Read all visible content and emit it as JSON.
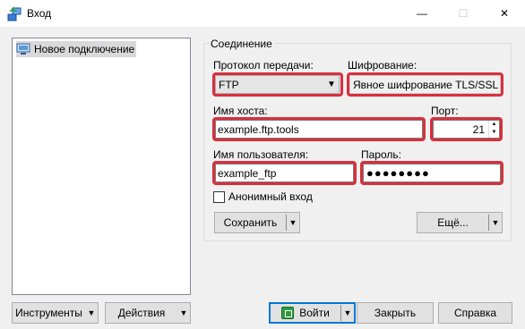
{
  "window": {
    "title": "Вход",
    "minimize": "—",
    "maximize": "☐",
    "close": "✕"
  },
  "tree": {
    "items": [
      {
        "label": "Новое подключение"
      }
    ]
  },
  "session": {
    "group_title": "Соединение",
    "protocol_label": "Протокол передачи:",
    "protocol_value": "FTP",
    "encryption_label": "Шифрование:",
    "encryption_value": "Явное шифрование TLS/SSL",
    "host_label": "Имя хоста:",
    "host_value": "example.ftp.tools",
    "port_label": "Порт:",
    "port_value": "21",
    "user_label": "Имя пользователя:",
    "user_value": "example_ftp",
    "password_label": "Пароль:",
    "password_value": "●●●●●●●●",
    "anonymous_label": "Анонимный вход",
    "anonymous_checked": false,
    "save_label": "Сохранить",
    "advanced_label": "Ещё..."
  },
  "footer": {
    "tools_label": "Инструменты",
    "actions_label": "Действия",
    "login_label": "Войти",
    "close_label": "Закрыть",
    "help_label": "Справка"
  },
  "colors": {
    "highlight": "#d92f3d",
    "default_button_border": "#0078d7",
    "selection": "#d9d9d9"
  },
  "icons": {
    "app": "winscp-app-icon",
    "site": "computer-site-icon",
    "login": "login-door-icon",
    "dropdown": "caret-down-icon"
  }
}
